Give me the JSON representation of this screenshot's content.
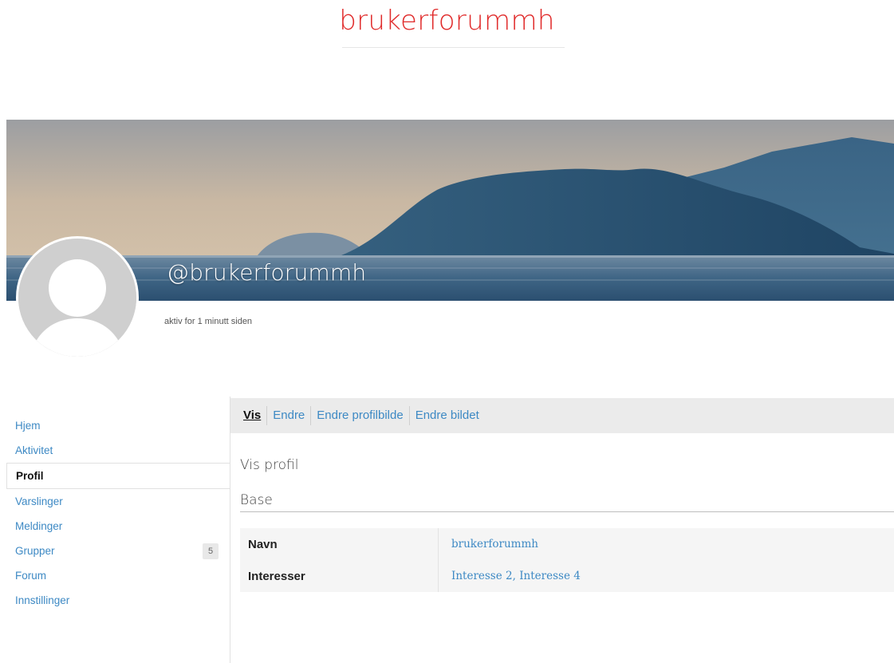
{
  "site": {
    "title": "brukerforummh"
  },
  "profile_header": {
    "username": "@brukerforummh",
    "last_active": "aktiv for 1 minutt siden"
  },
  "nav": {
    "items": [
      {
        "label": "Hjem",
        "current": false
      },
      {
        "label": "Aktivitet",
        "current": false
      },
      {
        "label": "Profil",
        "current": true
      },
      {
        "label": "Varslinger",
        "current": false
      },
      {
        "label": "Meldinger",
        "current": false
      },
      {
        "label": "Grupper",
        "current": false,
        "count": "5"
      },
      {
        "label": "Forum",
        "current": false
      },
      {
        "label": "Innstillinger",
        "current": false
      }
    ]
  },
  "subnav": {
    "items": [
      {
        "label": "Vis",
        "current": true
      },
      {
        "label": "Endre",
        "current": false
      },
      {
        "label": "Endre profilbilde",
        "current": false
      },
      {
        "label": "Endre bildet",
        "current": false
      }
    ]
  },
  "main": {
    "screen_heading": "Vis profil",
    "group_heading": "Base",
    "fields": [
      {
        "label": "Navn",
        "values": [
          "brukerforummh"
        ],
        "separator": ""
      },
      {
        "label": "Interesser",
        "values": [
          "Interesse 2",
          "Interesse 4"
        ],
        "separator": ", "
      }
    ]
  },
  "colors": {
    "title_red": "#e02b2b",
    "link_blue": "#3d89c4",
    "subnav_bg": "#ebebeb",
    "avatar_gray": "#cfcfcf"
  }
}
